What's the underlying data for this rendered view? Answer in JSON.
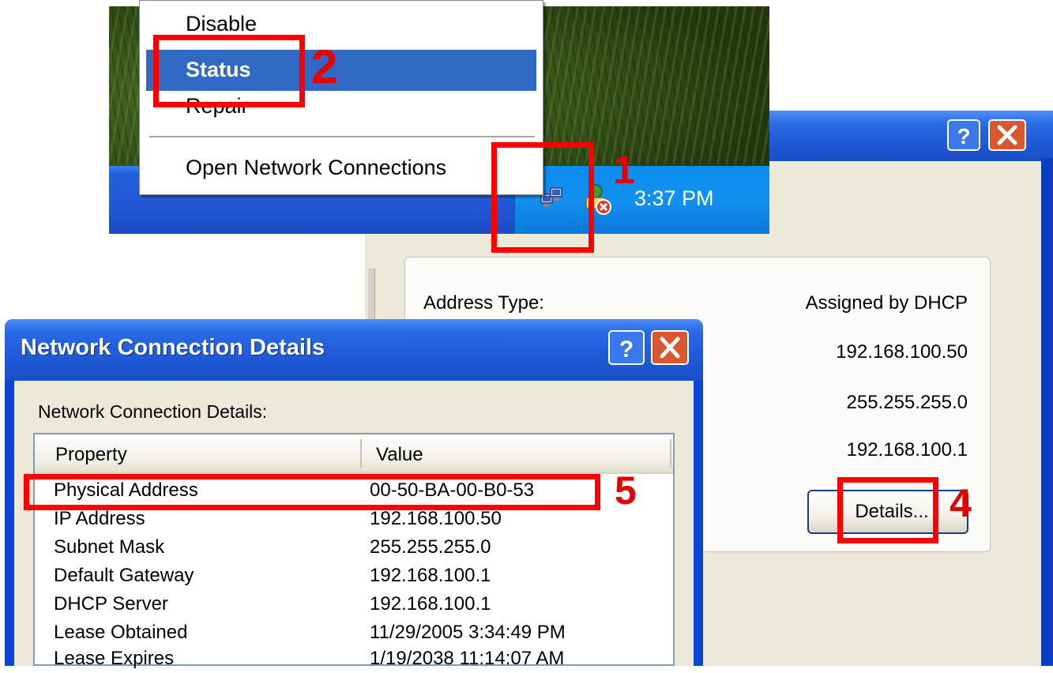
{
  "context_menu": {
    "items": [
      "Disable",
      "Status",
      "Repair",
      "Open Network Connections"
    ]
  },
  "taskbar": {
    "clock": "3:37 PM",
    "tray_icons": [
      "network-computers-icon",
      "network-disconnected-icon"
    ]
  },
  "status_window": {
    "address_type_label": "Address Type:",
    "address_type_value": "Assigned by DHCP",
    "ip_value": "192.168.100.50",
    "subnet_value": "255.255.255.0",
    "gateway_value": "192.168.100.1",
    "details_button": "Details..."
  },
  "details_dialog": {
    "title": "Network Connection Details",
    "subtitle": "Network Connection Details:",
    "columns": [
      "Property",
      "Value"
    ],
    "rows": [
      {
        "property": "Physical Address",
        "value": "00-50-BA-00-B0-53"
      },
      {
        "property": "IP Address",
        "value": "192.168.100.50"
      },
      {
        "property": "Subnet Mask",
        "value": "255.255.255.0"
      },
      {
        "property": "Default Gateway",
        "value": "192.168.100.1"
      },
      {
        "property": "DHCP Server",
        "value": "192.168.100.1"
      },
      {
        "property": "Lease Obtained",
        "value": "11/29/2005 3:34:49 PM"
      },
      {
        "property": "Lease Expires",
        "value": "1/19/2038 11:14:07 AM"
      }
    ]
  },
  "annotations": [
    "1",
    "2",
    "4",
    "5"
  ],
  "colors": {
    "annotation_red": "#ff0000",
    "xp_blue": "#245edb",
    "menu_highlight": "#316ac5"
  }
}
